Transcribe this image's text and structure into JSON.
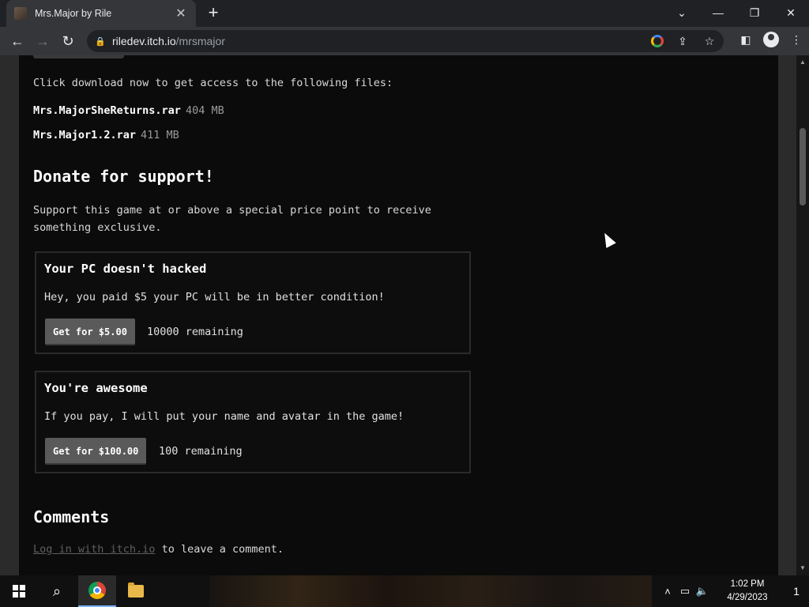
{
  "browser": {
    "tab_title": "Mrs.Major by Rile",
    "tab_close": "✕",
    "new_tab": "+",
    "url_host": "riledev.itch.io",
    "url_path": "/mrsmajor"
  },
  "page": {
    "intro": "Click download now to get access to the following files:",
    "files": [
      {
        "name": "Mrs.MajorSheReturns.rar",
        "size": "404 MB"
      },
      {
        "name": "Mrs.Major1.2.rar",
        "size": "411 MB"
      }
    ],
    "donate_heading": "Donate for support!",
    "support_text": "Support this game at or above a special price point to receive something exclusive.",
    "rewards": [
      {
        "title": "Your PC doesn't hacked",
        "description": "Hey, you paid $5 your PC will be in better condition!",
        "button": "Get for $5.00",
        "remaining": "10000 remaining"
      },
      {
        "title": "You're awesome",
        "description": "If you pay, I will put your name and avatar in the game!",
        "button": "Get for $100.00",
        "remaining": "100 remaining"
      }
    ],
    "comments_heading": "Comments",
    "login_link": "Log in with itch.io",
    "login_suffix": " to leave a comment."
  },
  "taskbar": {
    "time": "1:02 PM",
    "date": "4/29/2023",
    "notification_count": "1"
  },
  "icons": [
    "tab-favicon",
    "back-arrow-icon",
    "forward-arrow-icon",
    "reload-icon",
    "lock-icon",
    "google-icon",
    "share-icon",
    "star-icon",
    "sidebar-icon",
    "profile-icon",
    "menu-icon",
    "windows-icon",
    "search-icon",
    "chrome-icon",
    "folder-icon"
  ]
}
